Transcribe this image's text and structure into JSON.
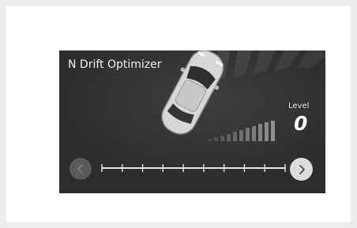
{
  "screen": {
    "title": "N Drift Optimizer",
    "level_label": "Level",
    "level_value": "0"
  },
  "slider": {
    "tick_count": 10,
    "current_step": 0
  },
  "icons": {
    "prev": "chevron-left-icon",
    "next": "chevron-right-icon",
    "car": "car-top-view-icon"
  },
  "colors": {
    "screen_bg": "#333333",
    "next_button": "#dcdcdc",
    "prev_button": "#5a5a5a"
  }
}
